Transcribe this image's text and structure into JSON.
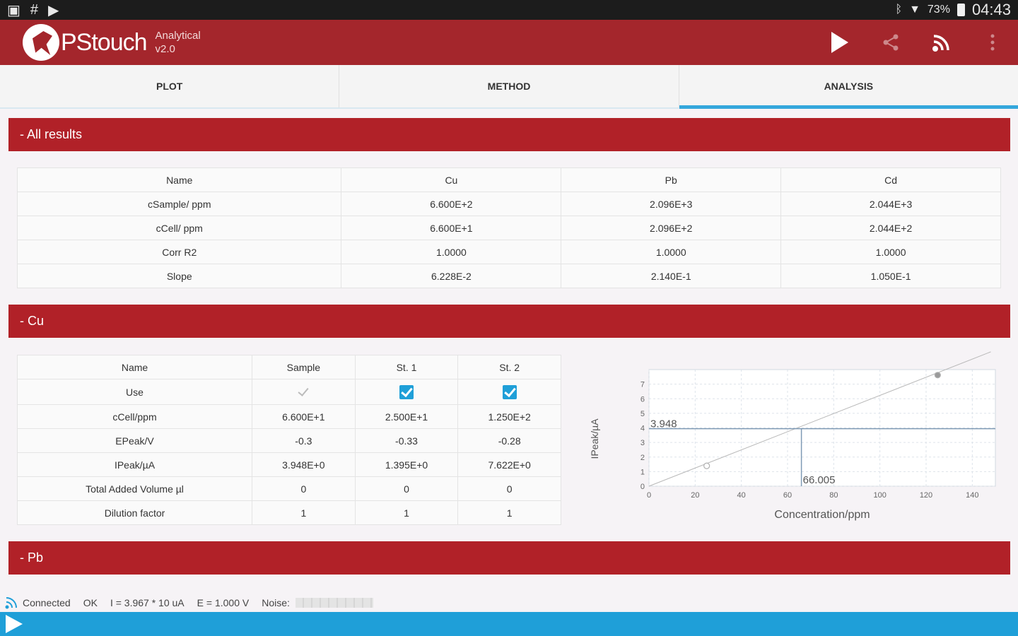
{
  "status_bar": {
    "battery": "73%",
    "time": "04:43",
    "left_icons": [
      "screenshot-icon",
      "hash-icon",
      "play-store-icon"
    ],
    "right_icons": [
      "bluetooth-icon",
      "wifi-icon",
      "battery-icon"
    ]
  },
  "app": {
    "name": "PStouch",
    "subtitle_line1": "Analytical",
    "subtitle_line2": "v2.0",
    "actions": [
      "play-icon",
      "share-icon",
      "connect-icon",
      "overflow-menu-icon"
    ]
  },
  "tabs": [
    {
      "label": "PLOT",
      "active": false
    },
    {
      "label": "METHOD",
      "active": false
    },
    {
      "label": "ANALYSIS",
      "active": true
    }
  ],
  "sections": {
    "all_results": "- All results",
    "cu": "- Cu",
    "pb": "- Pb"
  },
  "all_results_table": {
    "rows": [
      [
        "Name",
        "Cu",
        "Pb",
        "Cd"
      ],
      [
        "cSample/ ppm",
        "6.600E+2",
        "2.096E+3",
        "2.044E+3"
      ],
      [
        "cCell/ ppm",
        "6.600E+1",
        "2.096E+2",
        "2.044E+2"
      ],
      [
        "Corr R2",
        "1.0000",
        "1.0000",
        "1.0000"
      ],
      [
        "Slope",
        "6.228E-2",
        "2.140E-1",
        "1.050E-1"
      ]
    ]
  },
  "cu_table": {
    "header": [
      "Name",
      "Sample",
      "St. 1",
      "St. 2"
    ],
    "use_label": "Use",
    "use": [
      false,
      true,
      true
    ],
    "rows": [
      [
        "cCell/ppm",
        "6.600E+1",
        "2.500E+1",
        "1.250E+2"
      ],
      [
        "EPeak/V",
        "-0.3",
        "-0.33",
        "-0.28"
      ],
      [
        "IPeak/µA",
        "3.948E+0",
        "1.395E+0",
        "7.622E+0"
      ],
      [
        "Total Added Volume µl",
        "0",
        "0",
        "0"
      ],
      [
        "Dilution factor",
        "1",
        "1",
        "1"
      ]
    ]
  },
  "chart_data": {
    "type": "scatter",
    "xlabel": "Concentration/ppm",
    "ylabel": "IPeak/µA",
    "xlim": [
      0,
      150
    ],
    "ylim": [
      0,
      8
    ],
    "xticks": [
      "0",
      "20",
      "40",
      "60",
      "80",
      "100",
      "120",
      "140"
    ],
    "yticks": [
      "0",
      "1",
      "2",
      "3",
      "4",
      "5",
      "6",
      "7"
    ],
    "points": [
      {
        "x": 25,
        "y": 1.395
      },
      {
        "x": 125,
        "y": 7.622
      }
    ],
    "regression_line": {
      "slope": 0.06228,
      "intercept": 0.0
    },
    "annotation_y": "3.948",
    "annotation_x": "66.005",
    "marker_value": {
      "x": 66.005,
      "y": 3.948
    },
    "grid": true
  },
  "status_line": {
    "connected": "Connected",
    "state": "OK",
    "current": "I = 3.967 * 10 uA",
    "potential": "E = 1.000 V",
    "noise_label": "Noise:"
  }
}
